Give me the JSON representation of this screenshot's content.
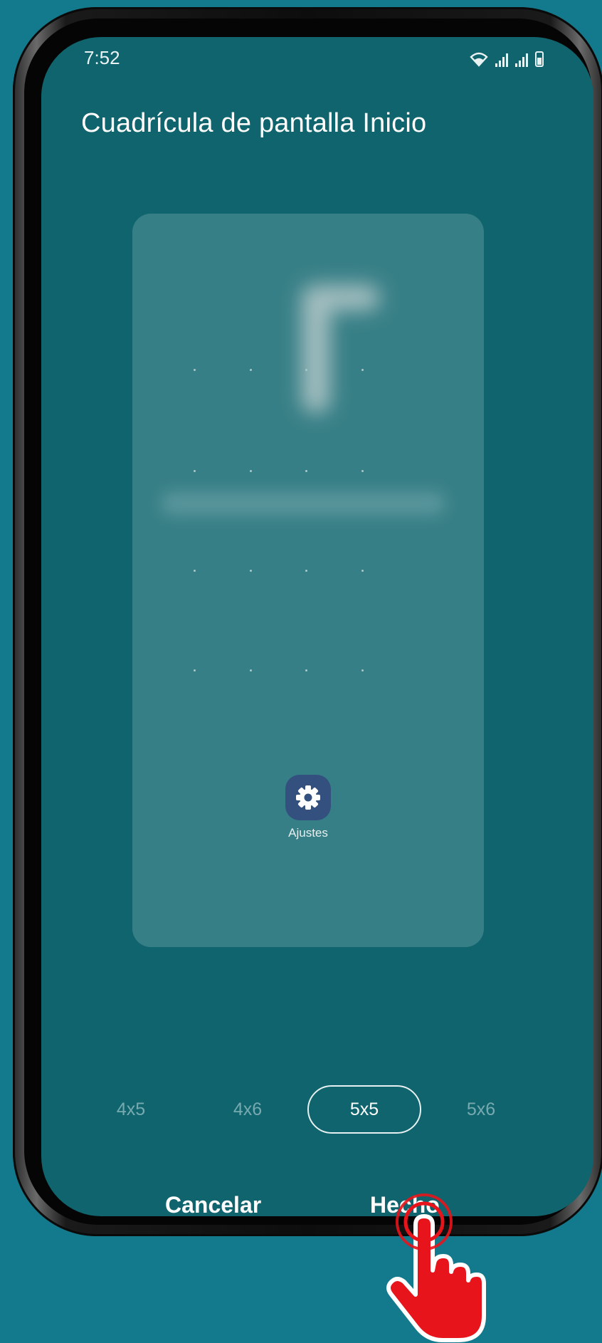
{
  "status_bar": {
    "time": "7:52",
    "icons": [
      "wifi-icon",
      "signal-icon",
      "signal-icon",
      "battery-icon"
    ]
  },
  "screen": {
    "title": "Cuadrícula de pantalla Inicio"
  },
  "preview": {
    "app_label": "Ajustes",
    "app_icon": "gear-icon"
  },
  "grid_options": [
    {
      "label": "4x5",
      "selected": false
    },
    {
      "label": "4x6",
      "selected": false
    },
    {
      "label": "5x5",
      "selected": true
    },
    {
      "label": "5x6",
      "selected": false
    }
  ],
  "actions": {
    "cancel_label": "Cancelar",
    "done_label": "Hecho"
  },
  "colors": {
    "background": "#127a8c",
    "screen": "#10646d",
    "preview_card": "#377f86",
    "pointer": "#e8141c"
  }
}
